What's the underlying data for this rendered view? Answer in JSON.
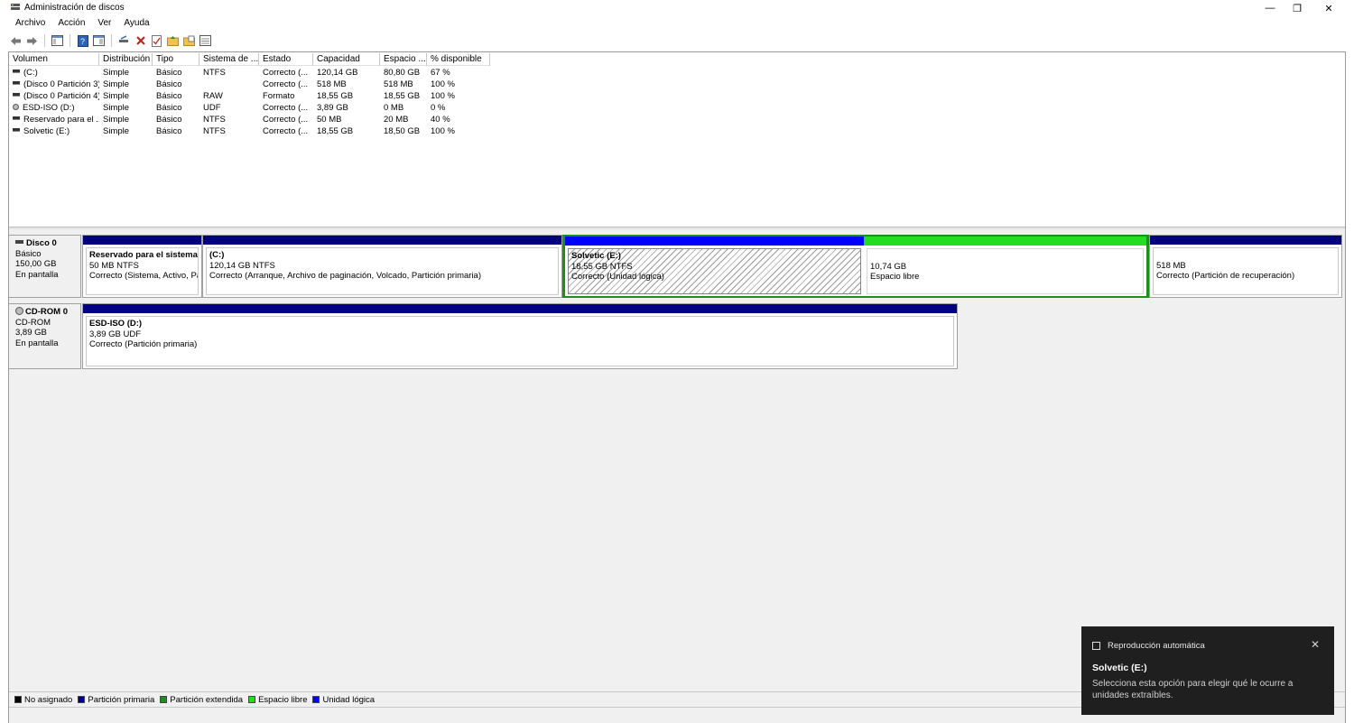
{
  "window": {
    "title": "Administración de discos",
    "min_glyph": "—",
    "max_glyph": "❐",
    "close_glyph": "✕"
  },
  "menu": [
    "Archivo",
    "Acción",
    "Ver",
    "Ayuda"
  ],
  "toolbar": [
    "back-arrow-icon",
    "forward-arrow-icon",
    "properties-pane-icon",
    "help-icon",
    "console-tree-icon",
    "connect-drive-icon",
    "delete-icon",
    "check-icon",
    "folder-up-icon",
    "folder-settings-icon",
    "list-view-icon"
  ],
  "volume_list": {
    "columns": [
      "Volumen",
      "Distribución",
      "Tipo",
      "Sistema de ...",
      "Estado",
      "Capacidad",
      "Espacio ...",
      "% disponible"
    ],
    "rows": [
      {
        "volume": "(C:)",
        "layout": "Simple",
        "type": "Básico",
        "fs": "NTFS",
        "status": "Correcto (...",
        "capacity": "120,14 GB",
        "free": "80,80 GB",
        "pct": "67 %",
        "icon": "disk"
      },
      {
        "volume": "(Disco 0 Partición 3)",
        "layout": "Simple",
        "type": "Básico",
        "fs": "",
        "status": "Correcto (...",
        "capacity": "518 MB",
        "free": "518 MB",
        "pct": "100 %",
        "icon": "disk"
      },
      {
        "volume": "(Disco 0 Partición 4)",
        "layout": "Simple",
        "type": "Básico",
        "fs": "RAW",
        "status": "Formato",
        "capacity": "18,55 GB",
        "free": "18,55 GB",
        "pct": "100 %",
        "icon": "disk"
      },
      {
        "volume": "ESD-ISO (D:)",
        "layout": "Simple",
        "type": "Básico",
        "fs": "UDF",
        "status": "Correcto (...",
        "capacity": "3,89 GB",
        "free": "0 MB",
        "pct": "0 %",
        "icon": "cd"
      },
      {
        "volume": "Reservado para el ...",
        "layout": "Simple",
        "type": "Básico",
        "fs": "NTFS",
        "status": "Correcto (...",
        "capacity": "50 MB",
        "free": "20 MB",
        "pct": "40 %",
        "icon": "disk"
      },
      {
        "volume": "Solvetic (E:)",
        "layout": "Simple",
        "type": "Básico",
        "fs": "NTFS",
        "status": "Correcto (...",
        "capacity": "18,55 GB",
        "free": "18,50 GB",
        "pct": "100 %",
        "icon": "disk"
      }
    ]
  },
  "disks": [
    {
      "name": "Disco 0",
      "kind": "Básico",
      "size": "150,00 GB",
      "state": "En pantalla",
      "partitions": [
        {
          "name": "Reservado para el sistema",
          "line1": "50 MB NTFS",
          "line2": "Correcto (Sistema, Activo, Par",
          "bar": "primary"
        },
        {
          "name": "(C:)",
          "line1": "120,14 GB NTFS",
          "line2": "Correcto (Arranque, Archivo de paginación, Volcado, Partición primaria)",
          "bar": "primary"
        },
        {
          "name": "Solvetic  (E:)",
          "line1": "18,55 GB NTFS",
          "line2": "Correcto (Unidad lógica)",
          "bar": "logical"
        },
        {
          "name": "",
          "line1": "10,74 GB",
          "line2": "Espacio libre",
          "bar": "free"
        },
        {
          "name": "",
          "line1": "518 MB",
          "line2": "Correcto (Partición de recuperación)",
          "bar": "primary"
        }
      ]
    },
    {
      "name": "CD-ROM 0",
      "kind": "CD-ROM",
      "size": "3,89 GB",
      "state": "En pantalla",
      "partitions": [
        {
          "name": "ESD-ISO  (D:)",
          "line1": "3,89 GB UDF",
          "line2": "Correcto (Partición primaria)",
          "bar": "primary"
        }
      ]
    }
  ],
  "legend": [
    {
      "label": "No asignado",
      "color": "#000000"
    },
    {
      "label": "Partición primaria",
      "color": "#000080"
    },
    {
      "label": "Partición extendida",
      "color": "#1d8f1d"
    },
    {
      "label": "Espacio libre",
      "color": "#22dd22"
    },
    {
      "label": "Unidad lógica",
      "color": "#0000ff"
    }
  ],
  "colors": {
    "primary": "#000080",
    "logical": "#0000ff",
    "free": "#22dd22",
    "extended": "#1d8f1d"
  },
  "toast": {
    "header": "Reproducción automática",
    "close_glyph": "✕",
    "title": "Solvetic (E:)",
    "message": "Selecciona esta opción para elegir qué le ocurre a unidades extraíbles."
  }
}
